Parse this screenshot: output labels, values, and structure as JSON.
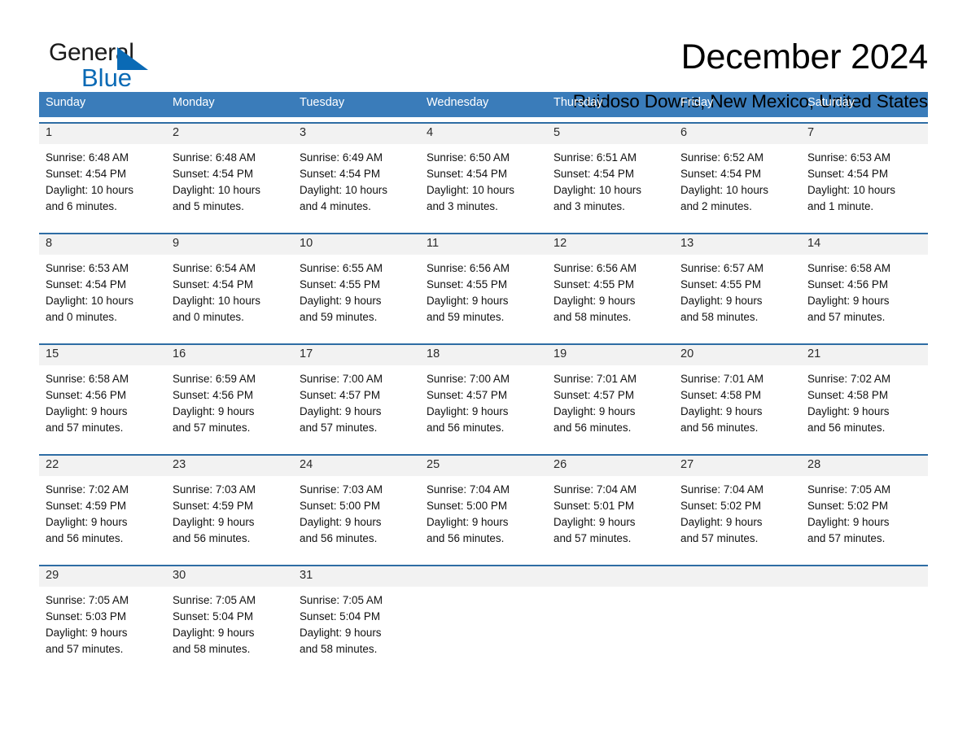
{
  "logo": {
    "word_general": "General",
    "word_blue": "Blue",
    "triangle_color": "#0a6ab5"
  },
  "header": {
    "month_title": "December 2024",
    "location": "Ruidoso Downs, New Mexico, United States"
  },
  "theme": {
    "header_blue": "#3a7cba",
    "row_rule_blue": "#2e6da4",
    "daynum_band": "#f2f2f2"
  },
  "weekdays": [
    "Sunday",
    "Monday",
    "Tuesday",
    "Wednesday",
    "Thursday",
    "Friday",
    "Saturday"
  ],
  "weeks": [
    [
      {
        "day": "1",
        "sunrise": "Sunrise: 6:48 AM",
        "sunset": "Sunset: 4:54 PM",
        "daylight1": "Daylight: 10 hours",
        "daylight2": "and 6 minutes."
      },
      {
        "day": "2",
        "sunrise": "Sunrise: 6:48 AM",
        "sunset": "Sunset: 4:54 PM",
        "daylight1": "Daylight: 10 hours",
        "daylight2": "and 5 minutes."
      },
      {
        "day": "3",
        "sunrise": "Sunrise: 6:49 AM",
        "sunset": "Sunset: 4:54 PM",
        "daylight1": "Daylight: 10 hours",
        "daylight2": "and 4 minutes."
      },
      {
        "day": "4",
        "sunrise": "Sunrise: 6:50 AM",
        "sunset": "Sunset: 4:54 PM",
        "daylight1": "Daylight: 10 hours",
        "daylight2": "and 3 minutes."
      },
      {
        "day": "5",
        "sunrise": "Sunrise: 6:51 AM",
        "sunset": "Sunset: 4:54 PM",
        "daylight1": "Daylight: 10 hours",
        "daylight2": "and 3 minutes."
      },
      {
        "day": "6",
        "sunrise": "Sunrise: 6:52 AM",
        "sunset": "Sunset: 4:54 PM",
        "daylight1": "Daylight: 10 hours",
        "daylight2": "and 2 minutes."
      },
      {
        "day": "7",
        "sunrise": "Sunrise: 6:53 AM",
        "sunset": "Sunset: 4:54 PM",
        "daylight1": "Daylight: 10 hours",
        "daylight2": "and 1 minute."
      }
    ],
    [
      {
        "day": "8",
        "sunrise": "Sunrise: 6:53 AM",
        "sunset": "Sunset: 4:54 PM",
        "daylight1": "Daylight: 10 hours",
        "daylight2": "and 0 minutes."
      },
      {
        "day": "9",
        "sunrise": "Sunrise: 6:54 AM",
        "sunset": "Sunset: 4:54 PM",
        "daylight1": "Daylight: 10 hours",
        "daylight2": "and 0 minutes."
      },
      {
        "day": "10",
        "sunrise": "Sunrise: 6:55 AM",
        "sunset": "Sunset: 4:55 PM",
        "daylight1": "Daylight: 9 hours",
        "daylight2": "and 59 minutes."
      },
      {
        "day": "11",
        "sunrise": "Sunrise: 6:56 AM",
        "sunset": "Sunset: 4:55 PM",
        "daylight1": "Daylight: 9 hours",
        "daylight2": "and 59 minutes."
      },
      {
        "day": "12",
        "sunrise": "Sunrise: 6:56 AM",
        "sunset": "Sunset: 4:55 PM",
        "daylight1": "Daylight: 9 hours",
        "daylight2": "and 58 minutes."
      },
      {
        "day": "13",
        "sunrise": "Sunrise: 6:57 AM",
        "sunset": "Sunset: 4:55 PM",
        "daylight1": "Daylight: 9 hours",
        "daylight2": "and 58 minutes."
      },
      {
        "day": "14",
        "sunrise": "Sunrise: 6:58 AM",
        "sunset": "Sunset: 4:56 PM",
        "daylight1": "Daylight: 9 hours",
        "daylight2": "and 57 minutes."
      }
    ],
    [
      {
        "day": "15",
        "sunrise": "Sunrise: 6:58 AM",
        "sunset": "Sunset: 4:56 PM",
        "daylight1": "Daylight: 9 hours",
        "daylight2": "and 57 minutes."
      },
      {
        "day": "16",
        "sunrise": "Sunrise: 6:59 AM",
        "sunset": "Sunset: 4:56 PM",
        "daylight1": "Daylight: 9 hours",
        "daylight2": "and 57 minutes."
      },
      {
        "day": "17",
        "sunrise": "Sunrise: 7:00 AM",
        "sunset": "Sunset: 4:57 PM",
        "daylight1": "Daylight: 9 hours",
        "daylight2": "and 57 minutes."
      },
      {
        "day": "18",
        "sunrise": "Sunrise: 7:00 AM",
        "sunset": "Sunset: 4:57 PM",
        "daylight1": "Daylight: 9 hours",
        "daylight2": "and 56 minutes."
      },
      {
        "day": "19",
        "sunrise": "Sunrise: 7:01 AM",
        "sunset": "Sunset: 4:57 PM",
        "daylight1": "Daylight: 9 hours",
        "daylight2": "and 56 minutes."
      },
      {
        "day": "20",
        "sunrise": "Sunrise: 7:01 AM",
        "sunset": "Sunset: 4:58 PM",
        "daylight1": "Daylight: 9 hours",
        "daylight2": "and 56 minutes."
      },
      {
        "day": "21",
        "sunrise": "Sunrise: 7:02 AM",
        "sunset": "Sunset: 4:58 PM",
        "daylight1": "Daylight: 9 hours",
        "daylight2": "and 56 minutes."
      }
    ],
    [
      {
        "day": "22",
        "sunrise": "Sunrise: 7:02 AM",
        "sunset": "Sunset: 4:59 PM",
        "daylight1": "Daylight: 9 hours",
        "daylight2": "and 56 minutes."
      },
      {
        "day": "23",
        "sunrise": "Sunrise: 7:03 AM",
        "sunset": "Sunset: 4:59 PM",
        "daylight1": "Daylight: 9 hours",
        "daylight2": "and 56 minutes."
      },
      {
        "day": "24",
        "sunrise": "Sunrise: 7:03 AM",
        "sunset": "Sunset: 5:00 PM",
        "daylight1": "Daylight: 9 hours",
        "daylight2": "and 56 minutes."
      },
      {
        "day": "25",
        "sunrise": "Sunrise: 7:04 AM",
        "sunset": "Sunset: 5:00 PM",
        "daylight1": "Daylight: 9 hours",
        "daylight2": "and 56 minutes."
      },
      {
        "day": "26",
        "sunrise": "Sunrise: 7:04 AM",
        "sunset": "Sunset: 5:01 PM",
        "daylight1": "Daylight: 9 hours",
        "daylight2": "and 57 minutes."
      },
      {
        "day": "27",
        "sunrise": "Sunrise: 7:04 AM",
        "sunset": "Sunset: 5:02 PM",
        "daylight1": "Daylight: 9 hours",
        "daylight2": "and 57 minutes."
      },
      {
        "day": "28",
        "sunrise": "Sunrise: 7:05 AM",
        "sunset": "Sunset: 5:02 PM",
        "daylight1": "Daylight: 9 hours",
        "daylight2": "and 57 minutes."
      }
    ],
    [
      {
        "day": "29",
        "sunrise": "Sunrise: 7:05 AM",
        "sunset": "Sunset: 5:03 PM",
        "daylight1": "Daylight: 9 hours",
        "daylight2": "and 57 minutes."
      },
      {
        "day": "30",
        "sunrise": "Sunrise: 7:05 AM",
        "sunset": "Sunset: 5:04 PM",
        "daylight1": "Daylight: 9 hours",
        "daylight2": "and 58 minutes."
      },
      {
        "day": "31",
        "sunrise": "Sunrise: 7:05 AM",
        "sunset": "Sunset: 5:04 PM",
        "daylight1": "Daylight: 9 hours",
        "daylight2": "and 58 minutes."
      },
      {
        "day": "",
        "sunrise": "",
        "sunset": "",
        "daylight1": "",
        "daylight2": ""
      },
      {
        "day": "",
        "sunrise": "",
        "sunset": "",
        "daylight1": "",
        "daylight2": ""
      },
      {
        "day": "",
        "sunrise": "",
        "sunset": "",
        "daylight1": "",
        "daylight2": ""
      },
      {
        "day": "",
        "sunrise": "",
        "sunset": "",
        "daylight1": "",
        "daylight2": ""
      }
    ]
  ]
}
